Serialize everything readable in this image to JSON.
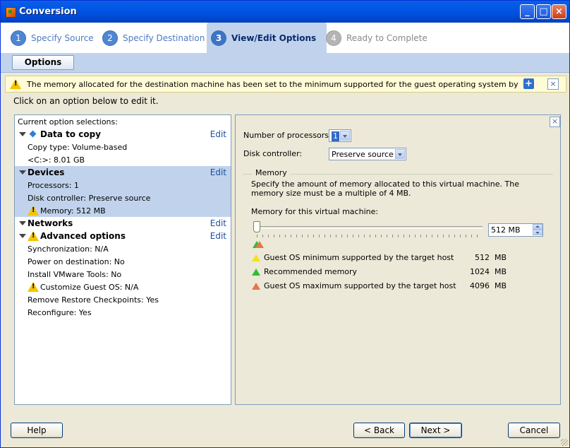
{
  "window": {
    "title": "Conversion"
  },
  "steps": [
    {
      "num": "1",
      "label": "Specify Source"
    },
    {
      "num": "2",
      "label": "Specify Destination"
    },
    {
      "num": "3",
      "label": "View/Edit Options"
    },
    {
      "num": "4",
      "label": "Ready to Complete"
    }
  ],
  "tab": {
    "label": "Options"
  },
  "warning": {
    "message": "The memory allocated for the destination machine has been set to the minimum supported for the guest operating system by the targ…"
  },
  "hint": "Click on an option below to edit it.",
  "left": {
    "header": "Current option selections:",
    "edit_label": "Edit",
    "data_to_copy": {
      "title": "Data to copy",
      "copy_type": "Copy type: Volume-based",
      "volume": "<C:>: 8.01 GB"
    },
    "devices": {
      "title": "Devices",
      "processors": "Processors: 1",
      "disk_controller": "Disk controller: Preserve source",
      "memory": "Memory: 512 MB"
    },
    "networks": {
      "title": "Networks"
    },
    "advanced": {
      "title": "Advanced options",
      "synchronization": "Synchronization: N/A",
      "power_on": "Power on destination: No",
      "install_tools": "Install VMware Tools: No",
      "customize_guest": "Customize Guest OS: N/A",
      "remove_checkpoints": "Remove Restore Checkpoints: Yes",
      "reconfigure": "Reconfigure: Yes"
    }
  },
  "right": {
    "processors_label": "Number of processors:",
    "processors_value": "1",
    "disk_label": "Disk controller:",
    "disk_value": "Preserve source",
    "memory_group": "Memory",
    "memory_desc": "Specify the amount of memory allocated to this virtual machine. The memory size must be a multiple of 4 MB.",
    "memory_for_vm": "Memory for this virtual machine:",
    "memory_value": "512 MB",
    "slider_position": 0,
    "legend": [
      {
        "color": "#f2e21c",
        "label": "Guest OS minimum supported by the target host",
        "value": "512",
        "unit": "MB"
      },
      {
        "color": "#2ec02e",
        "label": "Recommended memory",
        "value": "1024",
        "unit": "MB"
      },
      {
        "color": "#e8764a",
        "label": "Guest OS maximum supported by the target host",
        "value": "4096",
        "unit": "MB"
      }
    ]
  },
  "buttons": {
    "help": "Help",
    "back": "< Back",
    "next": "Next >",
    "cancel": "Cancel"
  }
}
